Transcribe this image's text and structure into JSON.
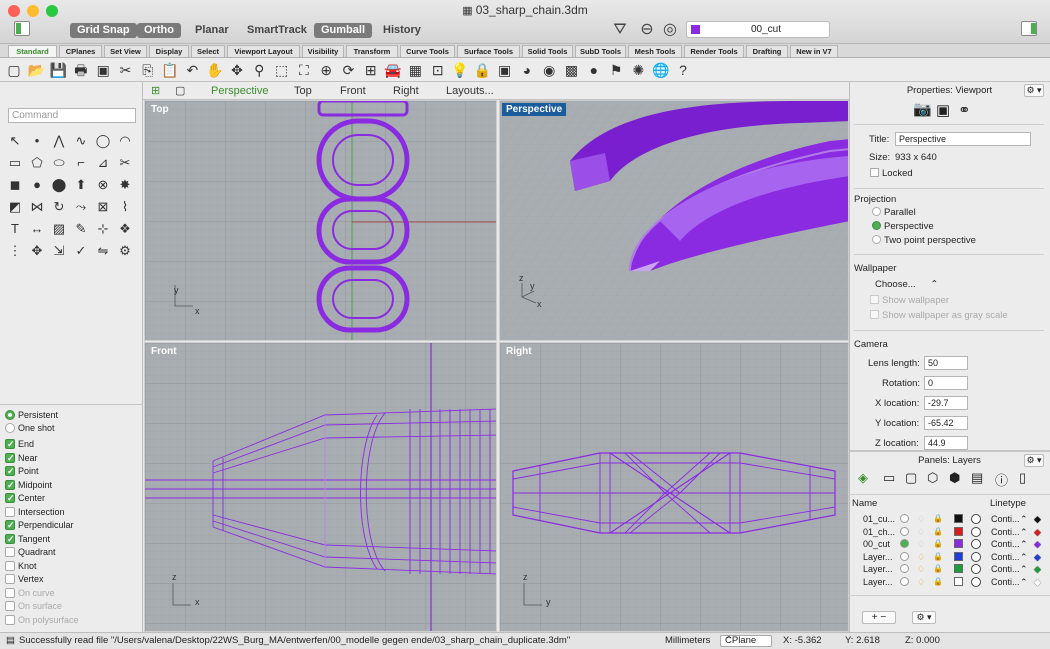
{
  "window": {
    "title": "03_sharp_chain.3dm"
  },
  "modes": {
    "grid_snap": "Grid Snap",
    "ortho": "Ortho",
    "planar": "Planar",
    "smarttrack": "SmartTrack",
    "gumball": "Gumball",
    "history": "History"
  },
  "current_layer": "00_cut",
  "colors": {
    "accent_green": "#3b8e2c",
    "geometry_purple": "#8a2be2",
    "active_viewport": "#1a5c9e",
    "viewport_bg": "#a8adb2"
  },
  "tabs": [
    "Standard",
    "CPlanes",
    "Set View",
    "Display",
    "Select",
    "Viewport Layout",
    "Visibility",
    "Transform",
    "Curve Tools",
    "Surface Tools",
    "Solid Tools",
    "SubD Tools",
    "Mesh Tools",
    "Render Tools",
    "Drafting",
    "New in V7"
  ],
  "command": {
    "placeholder": "Command"
  },
  "viewport_tabs": [
    "Perspective",
    "Top",
    "Front",
    "Right",
    "Layouts..."
  ],
  "viewports": {
    "top": {
      "label": "Top",
      "axis_y": "y",
      "axis_x": "x"
    },
    "perspective": {
      "label": "Perspective",
      "axis_z": "z",
      "axis_y": "y",
      "axis_x": "x"
    },
    "front": {
      "label": "Front",
      "axis_z": "z",
      "axis_x": "x"
    },
    "right": {
      "label": "Right",
      "axis_z": "z",
      "axis_y": "y"
    }
  },
  "osnap": {
    "persistent": "Persistent",
    "one_shot": "One shot",
    "items": [
      {
        "label": "End",
        "checked": true,
        "enabled": true
      },
      {
        "label": "Near",
        "checked": true,
        "enabled": true
      },
      {
        "label": "Point",
        "checked": true,
        "enabled": true
      },
      {
        "label": "Midpoint",
        "checked": true,
        "enabled": true
      },
      {
        "label": "Center",
        "checked": true,
        "enabled": true
      },
      {
        "label": "Intersection",
        "checked": false,
        "enabled": true
      },
      {
        "label": "Perpendicular",
        "checked": true,
        "enabled": true
      },
      {
        "label": "Tangent",
        "checked": true,
        "enabled": true
      },
      {
        "label": "Quadrant",
        "checked": false,
        "enabled": true
      },
      {
        "label": "Knot",
        "checked": false,
        "enabled": true
      },
      {
        "label": "Vertex",
        "checked": false,
        "enabled": true
      },
      {
        "label": "On curve",
        "checked": false,
        "enabled": false
      },
      {
        "label": "On surface",
        "checked": false,
        "enabled": false
      },
      {
        "label": "On polysurface",
        "checked": false,
        "enabled": false
      }
    ]
  },
  "properties": {
    "header": "Properties: Viewport",
    "title_label": "Title:",
    "title_value": "Perspective",
    "size_label": "Size:",
    "size_value": "933 x 640",
    "locked": "Locked",
    "projection_header": "Projection",
    "parallel": "Parallel",
    "perspective": "Perspective",
    "two_point": "Two point perspective",
    "wallpaper_header": "Wallpaper",
    "choose": "Choose...",
    "show_wallpaper": "Show wallpaper",
    "show_gray": "Show wallpaper as gray scale",
    "camera_header": "Camera",
    "lens_label": "Lens length:",
    "lens_value": "50",
    "rotation_label": "Rotation:",
    "rotation_value": "0",
    "xloc_label": "X location:",
    "xloc_value": "-29.7",
    "yloc_label": "Y location:",
    "yloc_value": "-65.42",
    "zloc_label": "Z location:",
    "zloc_value": "44.9"
  },
  "layers": {
    "header": "Panels: Layers",
    "col_name": "Name",
    "col_linetype": "Linetype",
    "rows": [
      {
        "name": "01_cu...",
        "color": "#111111",
        "linetype": "Conti...",
        "current": false,
        "bulb_on": false
      },
      {
        "name": "01_ch...",
        "color": "#d91e1e",
        "linetype": "Conti...",
        "current": false,
        "bulb_on": false
      },
      {
        "name": "00_cut",
        "color": "#8a2be2",
        "linetype": "Conti...",
        "current": true,
        "bulb_on": false
      },
      {
        "name": "Layer...",
        "color": "#1f3fd9",
        "linetype": "Conti...",
        "current": false,
        "bulb_on": true
      },
      {
        "name": "Layer...",
        "color": "#1e9e3a",
        "linetype": "Conti...",
        "current": false,
        "bulb_on": true
      },
      {
        "name": "Layer...",
        "color": "#ffffff",
        "linetype": "Conti...",
        "current": false,
        "bulb_on": true
      }
    ]
  },
  "status": {
    "message": "Successfully read file \"/Users/valena/Desktop/22WS_Burg_MA/entwerfen/00_modelle gegen ende/03_sharp_chain_duplicate.3dm\"",
    "units": "Millimeters",
    "cplane": "CPlane",
    "x": "X: -5.362",
    "y": "Y: 2.618",
    "z": "Z: 0.000"
  }
}
